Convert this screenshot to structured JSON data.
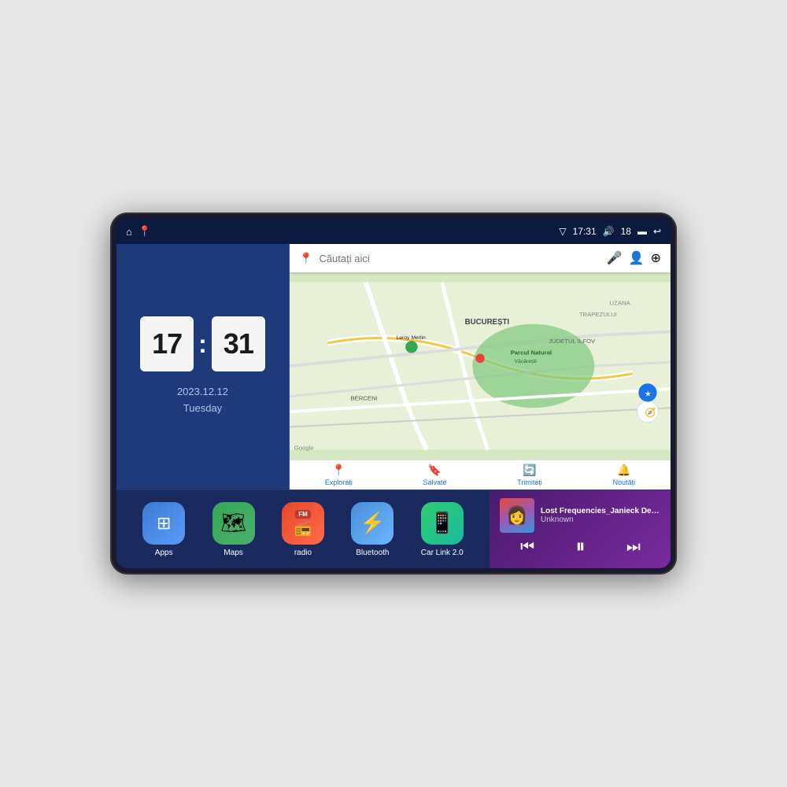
{
  "device": {
    "border_color": "#1a1a2e"
  },
  "status_bar": {
    "signal_icon": "▽",
    "time": "17:31",
    "volume_icon": "🔊",
    "battery_level": "18",
    "battery_icon": "▬",
    "back_icon": "↩"
  },
  "clock_widget": {
    "hour": "17",
    "minute": "31",
    "date": "2023.12.12",
    "day": "Tuesday"
  },
  "map_widget": {
    "search_placeholder": "Căutați aici",
    "nav_items": [
      {
        "label": "Explorați",
        "icon": "📍"
      },
      {
        "label": "Salvate",
        "icon": "🔖"
      },
      {
        "label": "Trimiteți",
        "icon": "🔄"
      },
      {
        "label": "Noutăți",
        "icon": "🔔"
      }
    ],
    "locations": [
      "Parcul Natural Văcărești",
      "Leroy Merlin",
      "BUCUREȘTI",
      "JUDEȚUL ILFOV",
      "BERCENI",
      "TRAPEZULUI",
      "UZANA"
    ]
  },
  "app_icons": [
    {
      "id": "apps",
      "label": "Apps",
      "class": "icon-apps",
      "icon": "⊞"
    },
    {
      "id": "maps",
      "label": "Maps",
      "class": "icon-maps",
      "icon": "🗺"
    },
    {
      "id": "radio",
      "label": "radio",
      "class": "icon-radio",
      "icon": "📻"
    },
    {
      "id": "bluetooth",
      "label": "Bluetooth",
      "class": "icon-bluetooth",
      "icon": "⚡"
    },
    {
      "id": "carlink",
      "label": "Car Link 2.0",
      "class": "icon-carlink",
      "icon": "📱"
    }
  ],
  "music_player": {
    "title": "Lost Frequencies_Janieck Devy-...",
    "artist": "Unknown",
    "prev_icon": "⏮",
    "play_icon": "⏸",
    "next_icon": "⏭"
  }
}
